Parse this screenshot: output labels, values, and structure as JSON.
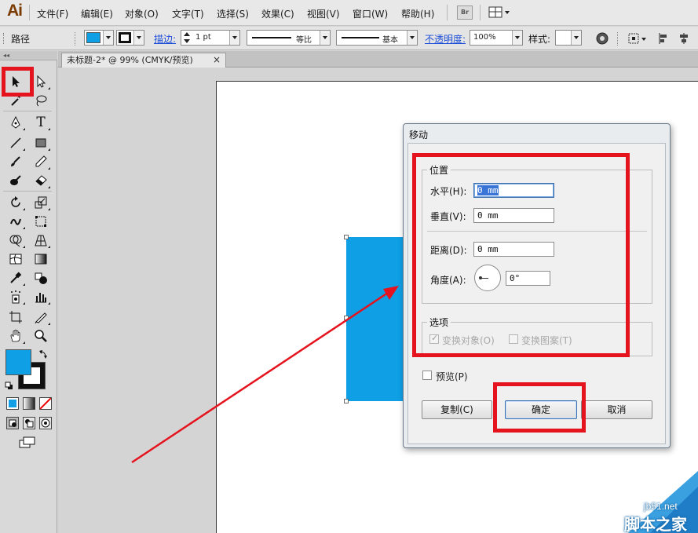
{
  "app": {
    "logo": "Ai"
  },
  "menu": {
    "items": [
      "文件(F)",
      "编辑(E)",
      "对象(O)",
      "文字(T)",
      "选择(S)",
      "效果(C)",
      "视图(V)",
      "窗口(W)",
      "帮助(H)"
    ],
    "bridge_label": "Br"
  },
  "control_bar": {
    "selection_type": "路径",
    "stroke_label": "描边:",
    "stroke_weight": "1 pt",
    "variable_width_label": "等比",
    "brush_label": "基本",
    "opacity_label": "不透明度:",
    "opacity_value": "100%",
    "style_label": "样式:",
    "fill_color": "#0e9fe5"
  },
  "tools": {
    "header_glyph": "◂◂",
    "items": [
      {
        "name": "selection-tool",
        "icon": "black-arrow",
        "active": true
      },
      {
        "name": "direct-selection-tool",
        "icon": "white-arrow"
      },
      {
        "name": "magic-wand-tool",
        "icon": "magic-wand"
      },
      {
        "name": "lasso-tool",
        "icon": "lasso"
      },
      {
        "name": "pen-tool",
        "icon": "pen"
      },
      {
        "name": "type-tool",
        "icon": "T",
        "glyph": "T"
      },
      {
        "name": "line-tool",
        "icon": "line"
      },
      {
        "name": "rectangle-tool",
        "icon": "rectangle"
      },
      {
        "name": "paintbrush-tool",
        "icon": "brush"
      },
      {
        "name": "pencil-tool",
        "icon": "pencil"
      },
      {
        "name": "blob-brush-tool",
        "icon": "blob-brush"
      },
      {
        "name": "eraser-tool",
        "icon": "eraser"
      },
      {
        "name": "rotate-tool",
        "icon": "rotate"
      },
      {
        "name": "scale-tool",
        "icon": "scale"
      },
      {
        "name": "warp-tool",
        "icon": "warp"
      },
      {
        "name": "free-transform-tool",
        "icon": "free-transform"
      },
      {
        "name": "shape-builder-tool",
        "icon": "shape-builder"
      },
      {
        "name": "perspective-grid-tool",
        "icon": "perspective"
      },
      {
        "name": "mesh-tool",
        "icon": "mesh"
      },
      {
        "name": "gradient-tool",
        "icon": "gradient"
      },
      {
        "name": "eyedropper-tool",
        "icon": "eyedropper"
      },
      {
        "name": "blend-tool",
        "icon": "blend"
      },
      {
        "name": "symbol-sprayer-tool",
        "icon": "symbol-sprayer"
      },
      {
        "name": "column-graph-tool",
        "icon": "graph"
      },
      {
        "name": "artboard-tool",
        "icon": "artboard"
      },
      {
        "name": "slice-tool",
        "icon": "slice"
      },
      {
        "name": "hand-tool",
        "icon": "hand"
      },
      {
        "name": "zoom-tool",
        "icon": "zoom"
      }
    ],
    "fill_color": "#0e9fe5",
    "stroke_color": "#000000"
  },
  "document": {
    "tab_title": "未标题-2* @ 99% (CMYK/预览)",
    "close_glyph": "×"
  },
  "dialog": {
    "title": "移动",
    "position_group": "位置",
    "horizontal_label": "水平(H):",
    "horizontal_value": "0 mm",
    "vertical_label": "垂直(V):",
    "vertical_value": "0 mm",
    "distance_label": "距离(D):",
    "distance_value": "0 mm",
    "angle_label": "角度(A):",
    "angle_value": "0°",
    "options_group": "选项",
    "transform_objects_label": "变换对象(O)",
    "transform_patterns_label": "变换图案(T)",
    "preview_label": "预览(P)",
    "copy_button": "复制(C)",
    "ok_button": "确定",
    "cancel_button": "取消"
  },
  "annotation": {
    "highlight_color": "#e5131d"
  },
  "watermark": {
    "url": "jb51.net",
    "name": "脚本之家"
  }
}
